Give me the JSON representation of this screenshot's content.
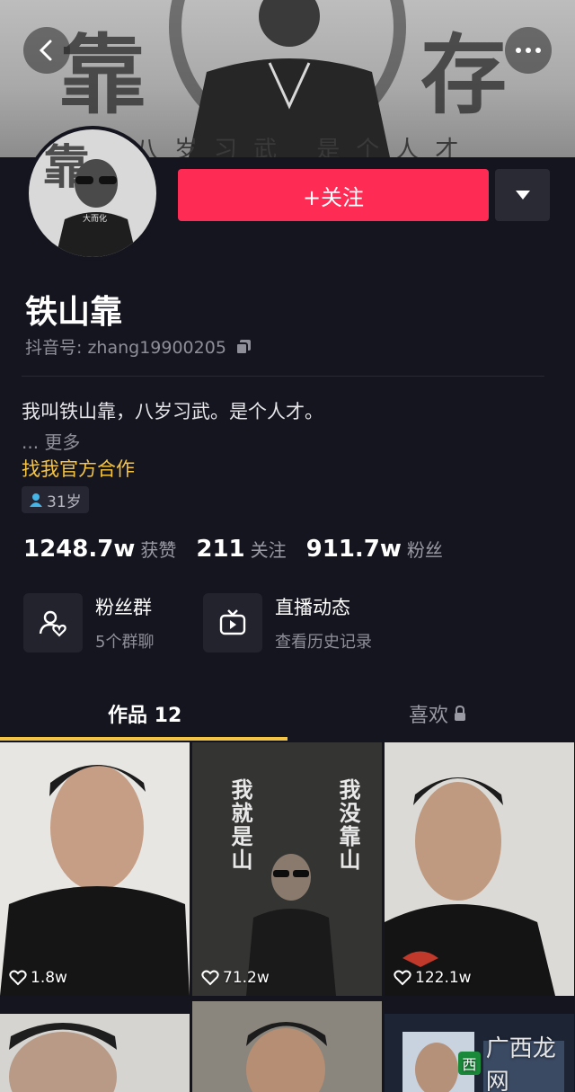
{
  "banner": {
    "left_char": "靠",
    "right_char": "存",
    "subtitle": "八岁习武 是个人才"
  },
  "profile": {
    "name": "铁山靠",
    "douyin_id": "抖音号: zhang19900205",
    "bio": "我叫铁山靠，八岁习武。是个人才。",
    "more": "... 更多",
    "business_link": "找我官方合作",
    "age": "31岁",
    "avatar_caption": "大而化"
  },
  "actions": {
    "follow_label": "+关注"
  },
  "stats": [
    {
      "value": "1248.7w",
      "label": "获赞"
    },
    {
      "value": "211",
      "label": "关注"
    },
    {
      "value": "911.7w",
      "label": "粉丝"
    }
  ],
  "features": {
    "fan_group": {
      "title": "粉丝群",
      "subtitle": "5个群聊"
    },
    "live": {
      "title": "直播动态",
      "subtitle": "查看历史记录"
    }
  },
  "tabs": {
    "works": "作品 12",
    "likes": "喜欢"
  },
  "videos": [
    {
      "likes": "1.8w"
    },
    {
      "likes": "71.2w",
      "text_left": "我就是山",
      "text_right": "我没靠山"
    },
    {
      "likes": "122.1w"
    }
  ],
  "watermark": {
    "logo": "西",
    "text": "广西龙网"
  },
  "colors": {
    "accent": "#fe2c55",
    "gold": "#f6c443",
    "background": "#15151f"
  }
}
